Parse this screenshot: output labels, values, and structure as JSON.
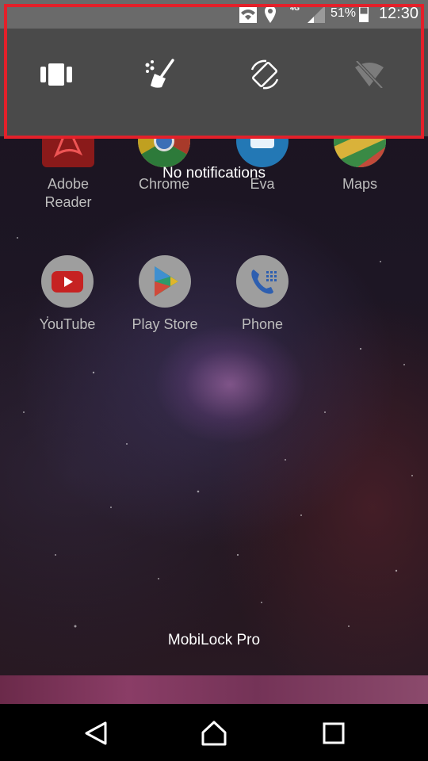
{
  "status_bar": {
    "network_type": "4G",
    "battery_percent": "51%",
    "time": "12:30",
    "icons": [
      "wifi-icon",
      "location-icon",
      "signal-icon",
      "battery-icon"
    ]
  },
  "quick_settings": {
    "tiles": [
      {
        "name": "app-switch-tile",
        "icon": "cards-icon"
      },
      {
        "name": "clean-tile",
        "icon": "broom-icon"
      },
      {
        "name": "auto-rotate-tile",
        "icon": "rotate-icon"
      },
      {
        "name": "wifi-off-tile",
        "icon": "wifi-off-icon"
      }
    ],
    "highlight_color": "#e3202a"
  },
  "notifications": {
    "empty_text": "No notifications"
  },
  "home": {
    "apps_row1": [
      {
        "label": "Adobe\nReader",
        "icon": "adobe-reader-icon"
      },
      {
        "label": "Chrome",
        "icon": "chrome-icon"
      },
      {
        "label": "Eva",
        "icon": "eva-icon"
      },
      {
        "label": "Maps",
        "icon": "maps-icon"
      }
    ],
    "apps_row2": [
      {
        "label": "YouTube",
        "icon": "youtube-icon"
      },
      {
        "label": "Play Store",
        "icon": "play-store-icon"
      },
      {
        "label": "Phone",
        "icon": "phone-icon"
      }
    ],
    "footer_label": "MobiLock Pro"
  },
  "nav_bar": {
    "buttons": [
      "back-icon",
      "home-icon",
      "recents-icon"
    ]
  }
}
